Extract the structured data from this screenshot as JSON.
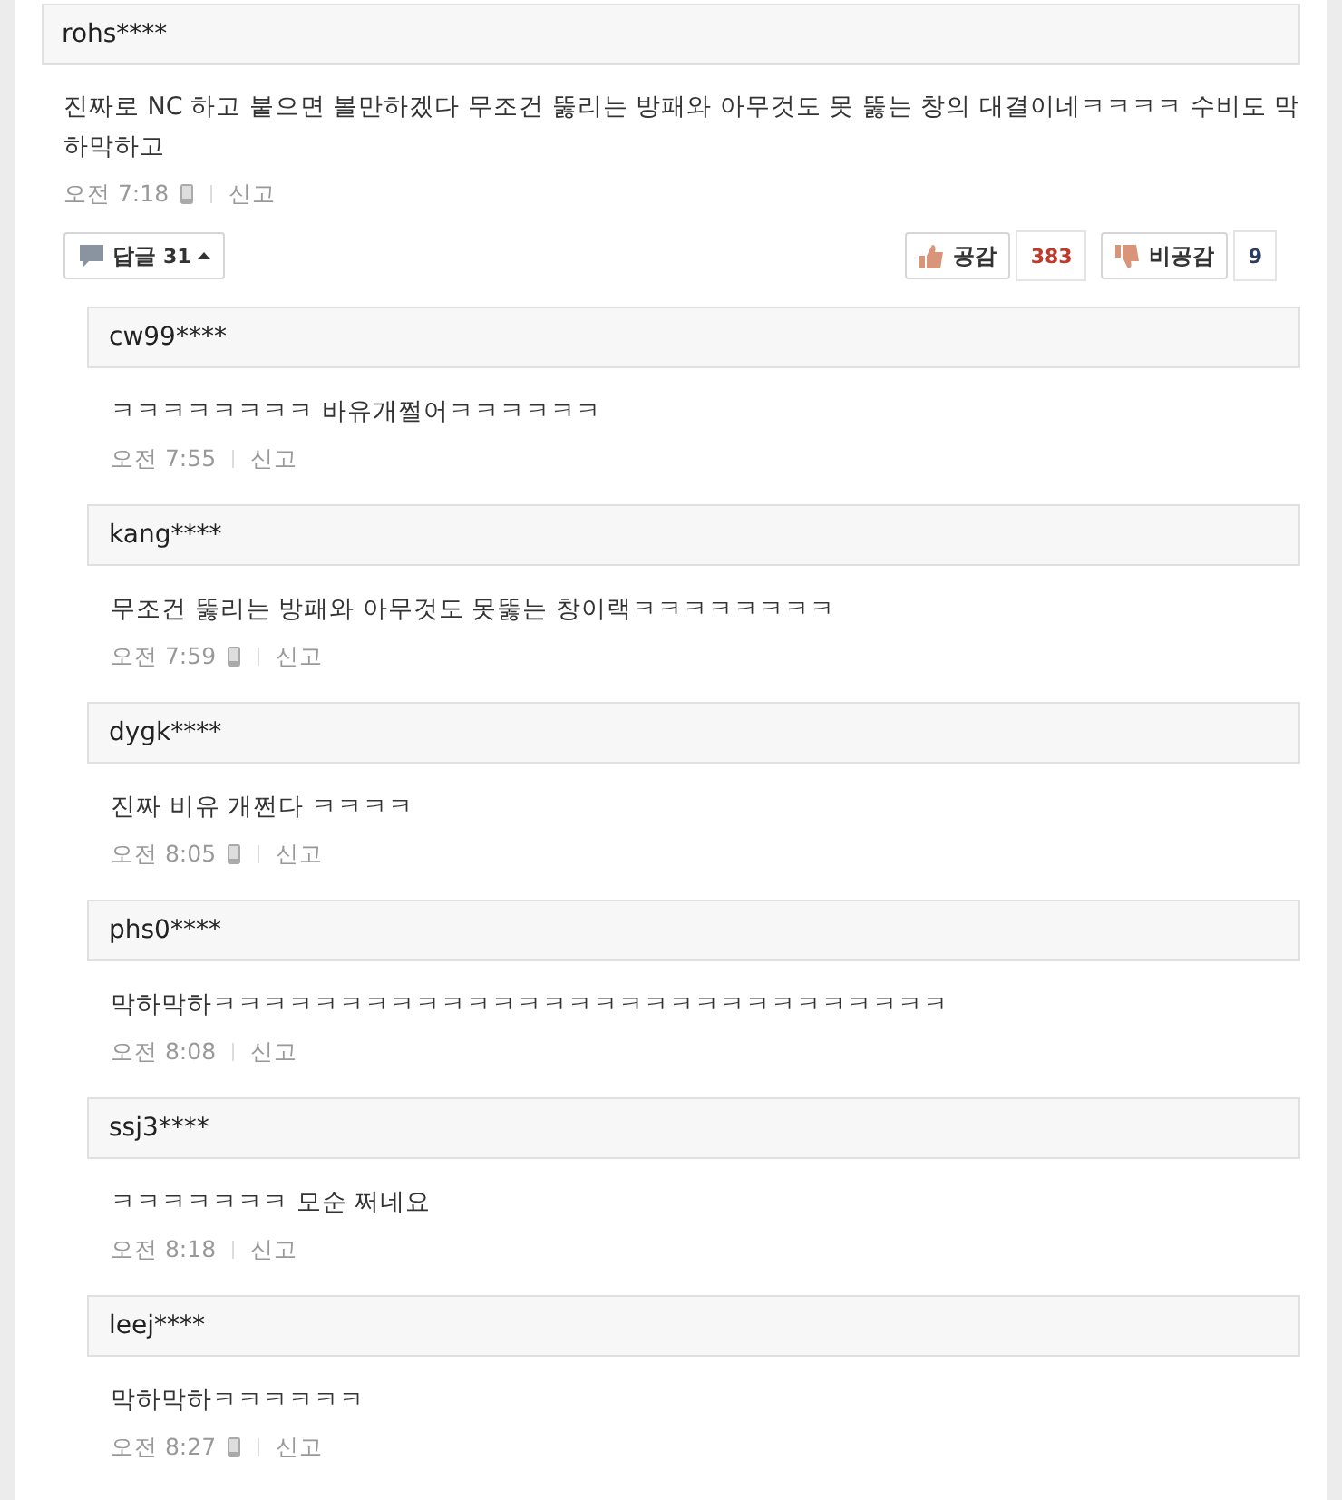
{
  "comment": {
    "author": "rohs****",
    "text": "진짜로 NC 하고 붙으면 볼만하겠다 무조건 뚫리는 방패와 아무것도 못 뚫는 창의 대결이네ㅋㅋㅋㅋ 수비도 막하막하고",
    "time": "오전 7:18",
    "mobile": true,
    "report": "신고",
    "reply_button": {
      "label": "답글",
      "count": "31",
      "expanded": true
    },
    "like": {
      "label": "공감",
      "count": "383"
    },
    "dislike": {
      "label": "비공감",
      "count": "9"
    }
  },
  "replies": [
    {
      "author": "cw99****",
      "text": "ㅋㅋㅋㅋㅋㅋㅋㅋ 바유개쩔어ㅋㅋㅋㅋㅋㅋ",
      "time": "오전 7:55",
      "mobile": false,
      "report": "신고"
    },
    {
      "author": "kang****",
      "text": "무조건 뚫리는 방패와 아무것도 못뚫는 창이랙ㅋㅋㅋㅋㅋㅋㅋㅋ",
      "time": "오전 7:59",
      "mobile": true,
      "report": "신고"
    },
    {
      "author": "dygk****",
      "text": "진짜 비유 개쩐다 ㅋㅋㅋㅋ",
      "time": "오전 8:05",
      "mobile": true,
      "report": "신고"
    },
    {
      "author": "phs0****",
      "text": "막하막하ㅋㅋㅋㅋㅋㅋㅋㅋㅋㅋㅋㅋㅋㅋㅋㅋㅋㅋㅋㅋㅋㅋㅋㅋㅋㅋㅋㅋㅋ",
      "time": "오전 8:08",
      "mobile": false,
      "report": "신고"
    },
    {
      "author": "ssj3****",
      "text": "ㅋㅋㅋㅋㅋㅋㅋ 모순 쩌네요",
      "time": "오전 8:18",
      "mobile": false,
      "report": "신고"
    },
    {
      "author": "leej****",
      "text": "막하막하ㅋㅋㅋㅋㅋㅋ",
      "time": "오전 8:27",
      "mobile": true,
      "report": "신고"
    }
  ]
}
